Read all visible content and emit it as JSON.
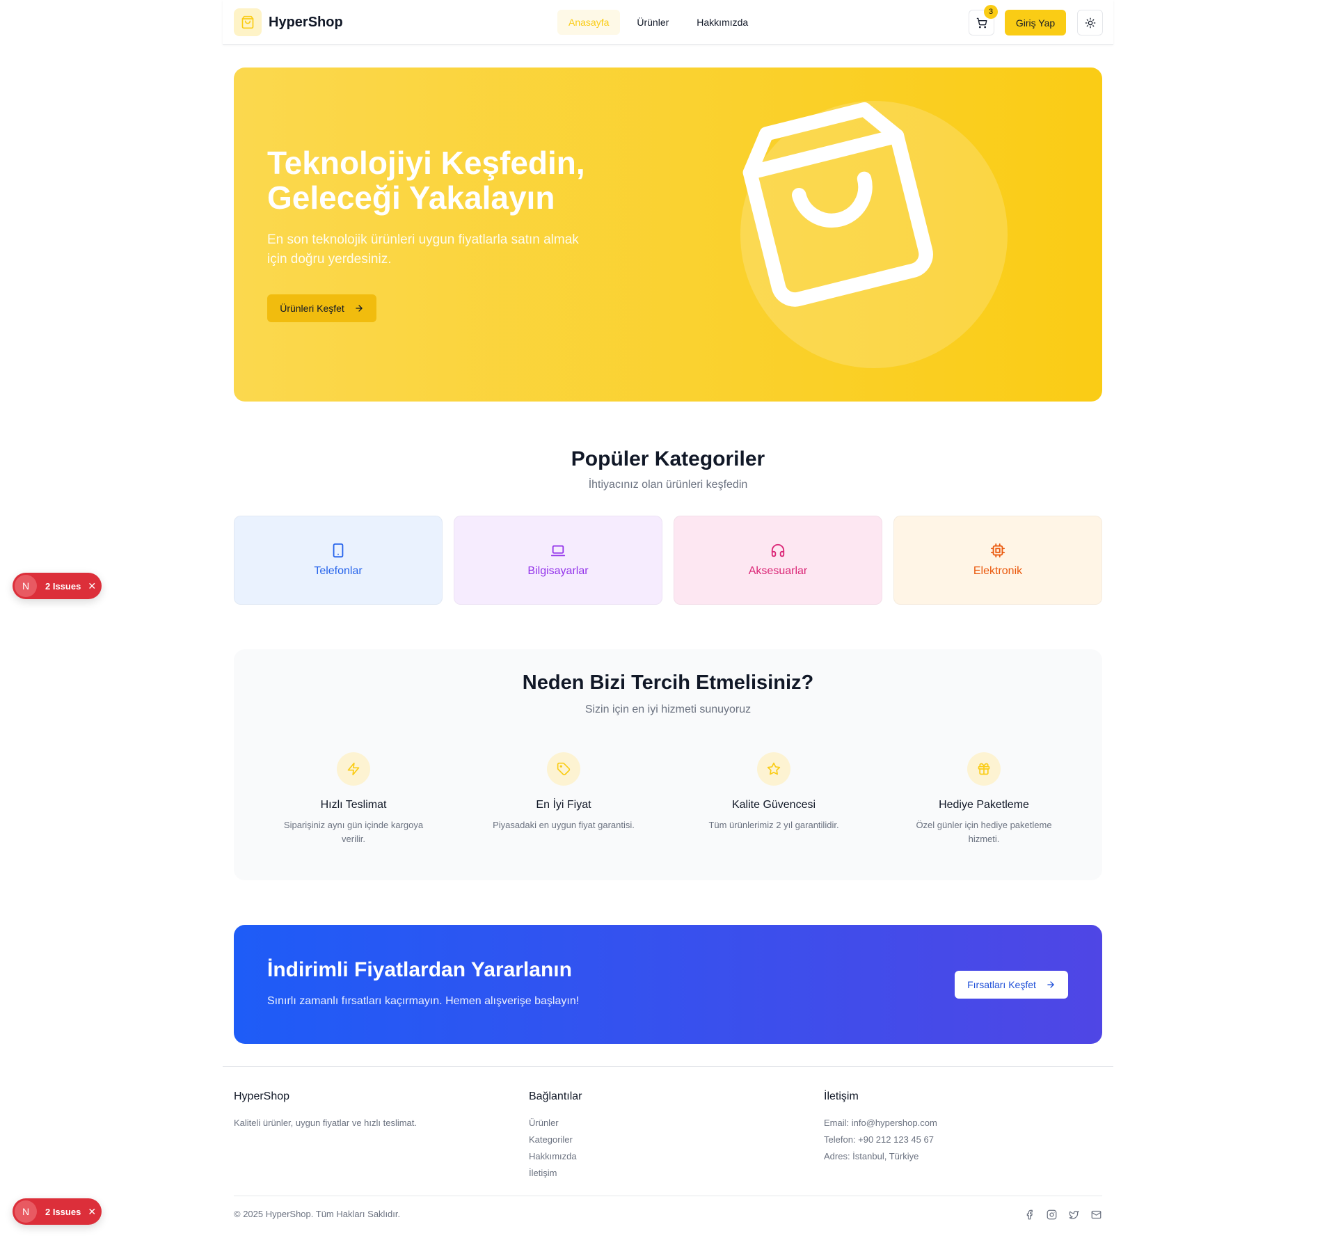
{
  "header": {
    "logo_text": "HyperShop",
    "nav": [
      "Anasayfa",
      "Ürünler",
      "Hakkımızda"
    ],
    "cart_count": "3",
    "login_label": "Giriş Yap"
  },
  "hero": {
    "title": "Teknolojiyi Keşfedin, Geleceği Yakalayın",
    "subtitle": "En son teknolojik ürünleri uygun fiyatlarla satın almak için doğru yerdesiniz.",
    "button_label": "Ürünleri Keşfet"
  },
  "categories": {
    "title": "Popüler Kategoriler",
    "subtitle": "İhtiyacınız olan ürünleri keşfedin",
    "items": [
      {
        "label": "Telefonlar",
        "icon": "smartphone-icon",
        "color": "#2563eb",
        "bg": "#eaf2fe"
      },
      {
        "label": "Bilgisayarlar",
        "icon": "laptop-icon",
        "color": "#9333ea",
        "bg": "#f6ecfe"
      },
      {
        "label": "Aksesuarlar",
        "icon": "headphones-icon",
        "color": "#db2777",
        "bg": "#fde7f2"
      },
      {
        "label": "Elektronik",
        "icon": "cpu-icon",
        "color": "#ea580c",
        "bg": "#fff5e6"
      }
    ]
  },
  "features": {
    "title": "Neden Bizi Tercih Etmelisiniz?",
    "subtitle": "Sizin için en iyi hizmeti sunuyoruz",
    "items": [
      {
        "title": "Hızlı Teslimat",
        "desc": "Siparişiniz aynı gün içinde kargoya verilir.",
        "icon": "zap-icon"
      },
      {
        "title": "En İyi Fiyat",
        "desc": "Piyasadaki en uygun fiyat garantisi.",
        "icon": "tag-icon"
      },
      {
        "title": "Kalite Güvencesi",
        "desc": "Tüm ürünlerimiz 2 yıl garantilidir.",
        "icon": "star-icon"
      },
      {
        "title": "Hediye Paketleme",
        "desc": "Özel günler için hediye paketleme hizmeti.",
        "icon": "gift-icon"
      }
    ]
  },
  "promo": {
    "title": "İndirimli Fiyatlardan Yararlanın",
    "subtitle": "Sınırlı zamanlı fırsatları kaçırmayın. Hemen alışverişe başlayın!",
    "button_label": "Fırsatları Keşfet"
  },
  "footer": {
    "brand": "HyperShop",
    "brand_desc": "Kaliteli ürünler, uygun fiyatlar ve hızlı teslimat.",
    "links_title": "Bağlantılar",
    "links": [
      "Ürünler",
      "Kategoriler",
      "Hakkımızda",
      "İletişim"
    ],
    "contact_title": "İletişim",
    "contact": [
      "Email: info@hypershop.com",
      "Telefon: +90 212 123 45 67",
      "Adres: İstanbul, Türkiye"
    ],
    "copyright": "© 2025 HyperShop. Tüm Hakları Saklıdır.",
    "socials": [
      "facebook-icon",
      "instagram-icon",
      "twitter-icon",
      "mail-icon"
    ]
  },
  "issues": {
    "letter": "N",
    "label": "2 Issues"
  },
  "colors": {
    "accent": "#facc15",
    "promo_start": "#1e5cf7",
    "promo_end": "#4f46e5"
  }
}
